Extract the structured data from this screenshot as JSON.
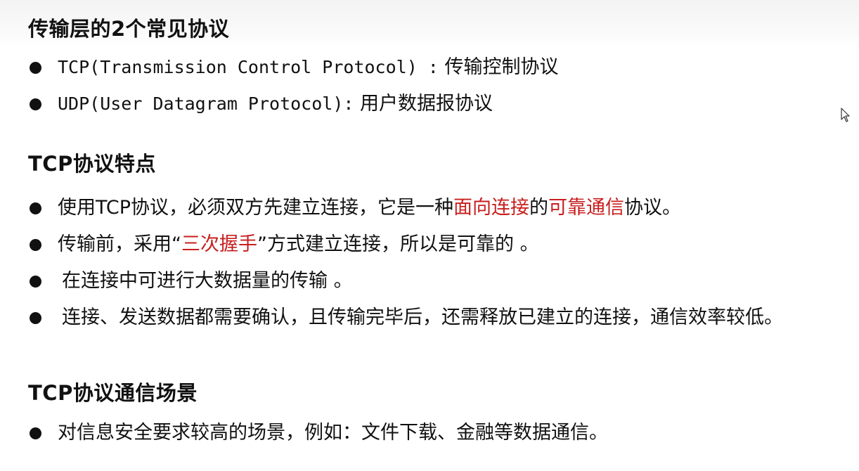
{
  "section1": {
    "heading": "传输层的2个常见协议",
    "items": [
      {
        "code": "TCP(Transmission Control Protocol) :",
        "desc": " 传输控制协议"
      },
      {
        "code": "UDP(User Datagram Protocol):",
        "desc": " 用户数据报协议"
      }
    ]
  },
  "section2": {
    "heading": "TCP协议特点",
    "item1": {
      "a": "使用TCP协议，必须双方先建立连接，它是一种",
      "b": "面向连接",
      "c": "的",
      "d": "可靠通信",
      "e": "协议。"
    },
    "item2": {
      "a": "传输前，采用“",
      "b": "三次握手",
      "c": "”方式建立连接，所以是可靠的 。"
    },
    "item3": "在连接中可进行大数据量的传输 。",
    "item4": "连接、发送数据都需要确认，且传输完毕后，还需释放已建立的连接，通信效率较低。"
  },
  "section3": {
    "heading": "TCP协议通信场景",
    "item1": "对信息安全要求较高的场景，例如：文件下载、金融等数据通信。"
  },
  "colors": {
    "text": "#111111",
    "highlight": "#c81e1e"
  },
  "icons": {
    "bullet": "bullet-dot",
    "cursor": "mouse-pointer-icon"
  }
}
